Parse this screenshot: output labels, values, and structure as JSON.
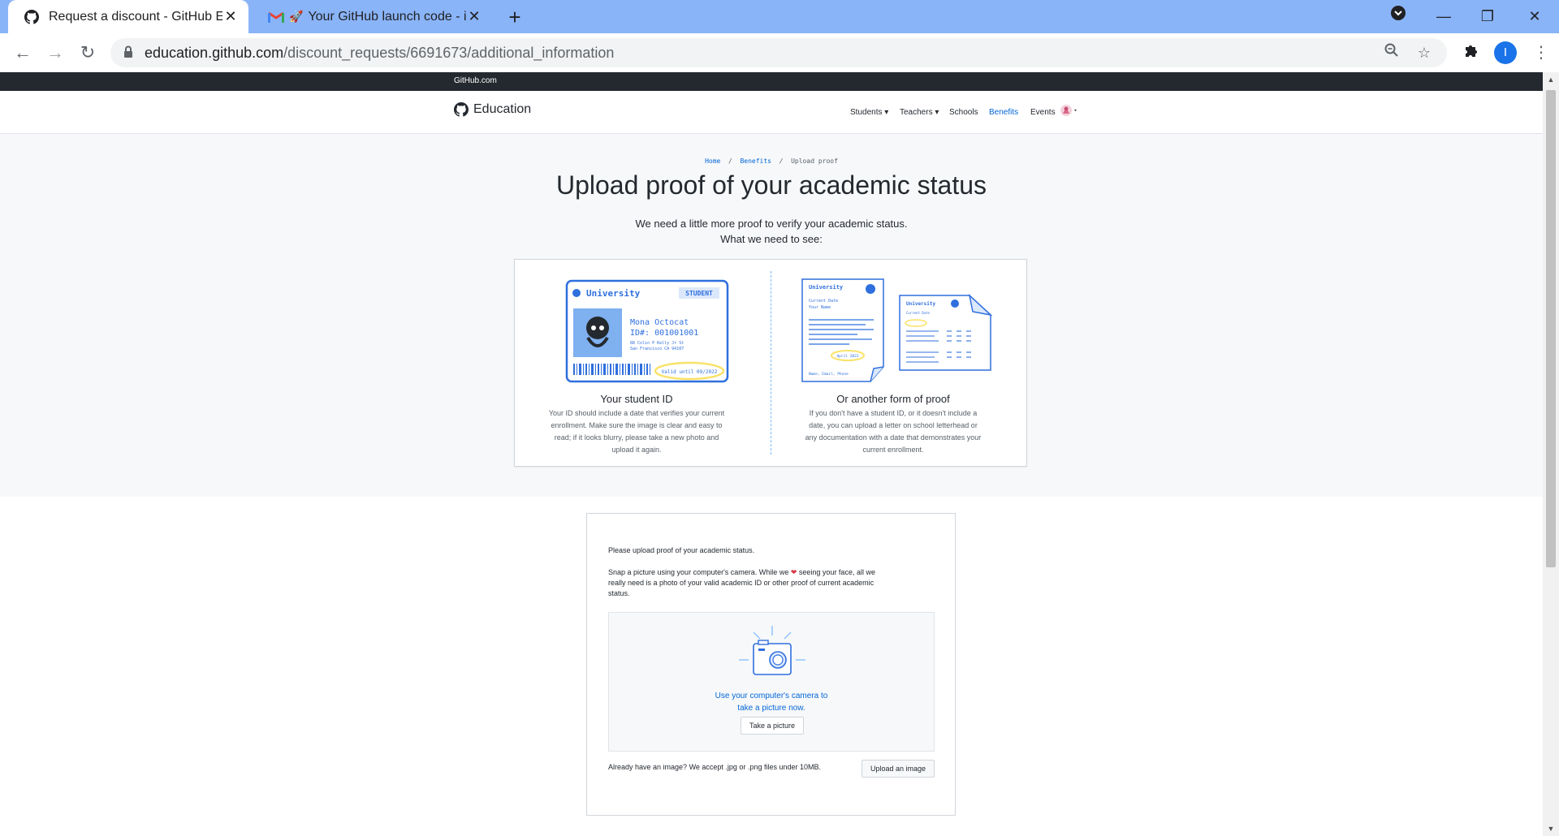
{
  "browser": {
    "tabs": [
      {
        "title": "Request a discount - GitHub Edu",
        "active": true
      },
      {
        "title": "Your GitHub launch code - ico",
        "active": false
      }
    ],
    "url_domain": "education.github.com",
    "url_path": "/discount_requests/6691673/additional_information",
    "profile_initial": "I"
  },
  "gh_header": {
    "label": "GitHub.com"
  },
  "site_nav": {
    "logo_text": "Education",
    "items": [
      {
        "label": "Students ▾"
      },
      {
        "label": "Teachers ▾"
      },
      {
        "label": "Schools"
      },
      {
        "label": "Benefits",
        "active": true
      },
      {
        "label": "Events"
      }
    ]
  },
  "breadcrumb": {
    "home": "Home",
    "benefits": "Benefits",
    "current": "Upload proof"
  },
  "heading": "Upload proof of your academic status",
  "intro": {
    "line1": "We need a little more proof to verify your academic status.",
    "line2": "What we need to see:"
  },
  "proof_options": {
    "student_id": {
      "title": "Your student ID",
      "description": "Your ID should include a date that verifies your current enrollment. Make sure the image is clear and easy to read; if it looks blurry, please take a new photo and upload it again.",
      "card": {
        "university": "University",
        "badge": "STUDENT",
        "name": "Mona Octocat",
        "id": "ID#: 001001001",
        "address1": "88 Colin P Kelly Jr St",
        "address2": "San Francisco CA 94107",
        "valid": "Valid until 09/2022"
      }
    },
    "other_proof": {
      "title": "Or another form of proof",
      "description": "If you don't have a student ID, or it doesn't include a date, you can upload a letter on school letterhead or any documentation with a date that demonstrates your current enrollment.",
      "doc": {
        "university": "University",
        "current_date": "Current Date",
        "your_name": "Your Name",
        "date": "April 2022",
        "footer": "Name, Email, Phone"
      }
    }
  },
  "upload": {
    "prompt": "Please upload proof of your academic status.",
    "snap_before": "Snap a picture using your computer's camera. While we",
    "snap_after": "seeing your face, all we really need is a photo of your valid academic ID or other proof of current academic status.",
    "camera_line1": "Use your computer's camera to",
    "camera_line2": "take a picture now.",
    "take_picture": "Take a picture",
    "already_have": "Already have an image? We accept .jpg or .png files under 10MB.",
    "upload_image": "Upload an image"
  },
  "colors": {
    "tabbar": "#8ab4f8",
    "link": "#0366d6",
    "dark": "#24292f",
    "hero_bg": "#f6f8fa",
    "heart": "#d73a49",
    "highlight": "#f9e26a"
  }
}
